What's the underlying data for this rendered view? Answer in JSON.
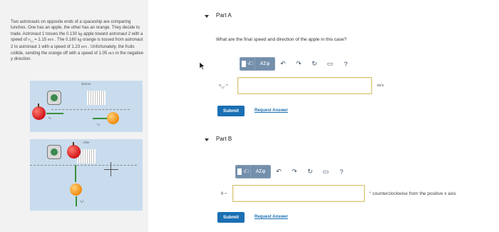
{
  "problem": {
    "text_1": "Two astronauts on opposite ends of a spaceship are comparing lunches. One has an apple, the other has an orange. They decide to trade. Astronaut 1 tosses the 0.130 ",
    "unit_kg_1": "kg",
    "text_2": " apple toward astronaut 2 with a speed of ",
    "var_v1i": "v",
    "var_v1i_sub": "1,i",
    "text_3": " = 1.15 ",
    "unit_ms_1": "m/s",
    "text_4": " . The 0.160 ",
    "unit_kg_2": "kg",
    "text_5": " orange is tossed from astronaut 2 to astronaut 1 with a speed of 1.23 ",
    "unit_ms_2": "m/s",
    "text_6": " . Unfortunately, the fruits collide, sending the orange off with a speed of 1.05 ",
    "unit_ms_3": "m/s",
    "text_7": " in the negative y direction."
  },
  "figures": {
    "before_label": "Before",
    "after_label": "After",
    "before_vec_label": "v₁ᵢ",
    "before_vec2_label": "v₂ᵢ",
    "after_vec_label": "v₂f"
  },
  "part_a": {
    "title": "Part A",
    "question": "What are the final speed and direction of the apple in this case?",
    "toolbar": {
      "template": "√□",
      "symbols": "ΑΣφ",
      "help": "?"
    },
    "answer_label_var": "v",
    "answer_label_sub": "1,f",
    "answer_label_eq": " =",
    "answer_value": "",
    "unit": "m/s",
    "submit_label": "Submit",
    "request_label": "Request Answer"
  },
  "part_b": {
    "title": "Part B",
    "toolbar": {
      "template": "√□",
      "symbols": "ΑΣφ",
      "help": "?"
    },
    "answer_label": "θ =",
    "answer_value": "",
    "unit": "° counterclockwise from the positive x axis",
    "submit_label": "Submit",
    "request_label": "Request Answer"
  },
  "colors": {
    "submit": "#1a6fb3",
    "toolbar": "#6f8aa6",
    "figure_bg": "#c8dcee",
    "input_border": "#d8c680"
  }
}
